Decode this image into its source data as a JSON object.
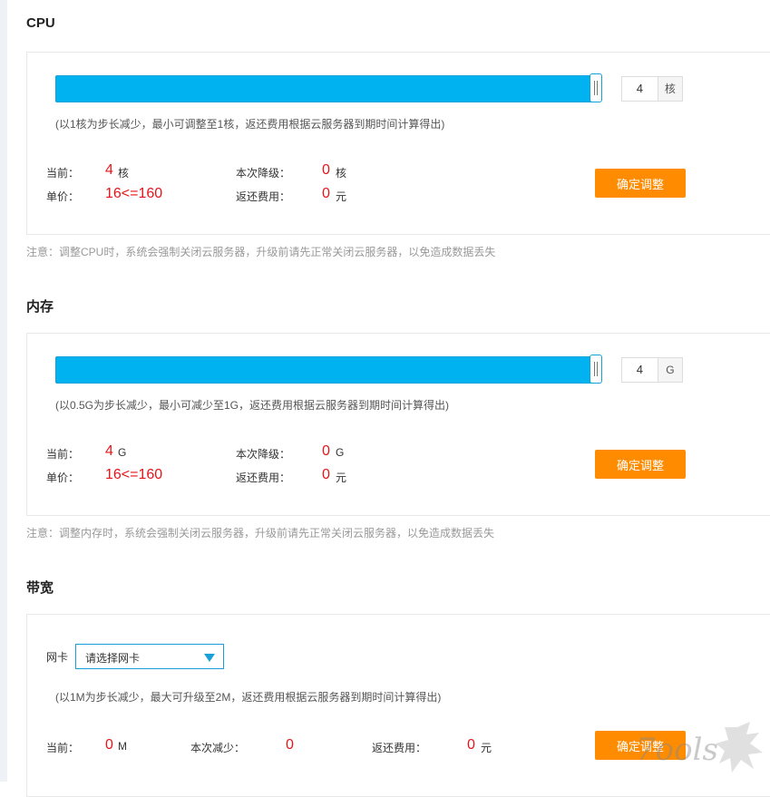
{
  "cpu": {
    "title": "CPU",
    "slider_value": 4,
    "slider_fill_fraction": 1.0,
    "unit": "核",
    "hint": "(以1核为步长减少，最小可调整至1核，返还费用根据云服务器到期时间计算得出)",
    "current_label": "当前：",
    "current_value": "4",
    "current_unit": "核",
    "reduce_label": "本次降级：",
    "reduce_value": "0",
    "reduce_unit": "核",
    "price_label": "单价：",
    "price_value": "16<=160",
    "refund_label": "返还费用：",
    "refund_value": "0",
    "refund_unit": "元",
    "button": "确定调整",
    "note": "注意：调整CPU时，系统会强制关闭云服务器，升级前请先正常关闭云服务器，以免造成数据丢失"
  },
  "memory": {
    "title": "内存",
    "slider_value": 4,
    "slider_fill_fraction": 1.0,
    "unit": "G",
    "hint": "(以0.5G为步长减少，最小可减少至1G，返还费用根据云服务器到期时间计算得出)",
    "current_label": "当前：",
    "current_value": "4",
    "current_unit": "G",
    "reduce_label": "本次降级：",
    "reduce_value": "0",
    "reduce_unit": "G",
    "price_label": "单价：",
    "price_value": "16<=160",
    "refund_label": "返还费用：",
    "refund_value": "0",
    "refund_unit": "元",
    "button": "确定调整",
    "note": "注意：调整内存时，系统会强制关闭云服务器，升级前请先正常关闭云服务器，以免造成数据丢失"
  },
  "bandwidth": {
    "title": "带宽",
    "nic_label": "网卡",
    "nic_select": "请选择网卡",
    "hint": "(以1M为步长减少，最大可升级至2M，返还费用根据云服务器到期时间计算得出)",
    "current_label": "当前：",
    "current_value": "0",
    "current_unit": "M",
    "reduce_label": "本次减少：",
    "reduce_value": "0",
    "refund_label": "返还费用：",
    "refund_value": "0",
    "refund_unit": "元",
    "button": "确定调整"
  },
  "watermark": "7ools",
  "colors": {
    "accent": "#00b3f0",
    "button": "#ff8c00",
    "price": "#e4161b"
  },
  "icons": {
    "select_caret": "chevron-down-icon",
    "slider_grip": "drag-handle-icon"
  }
}
